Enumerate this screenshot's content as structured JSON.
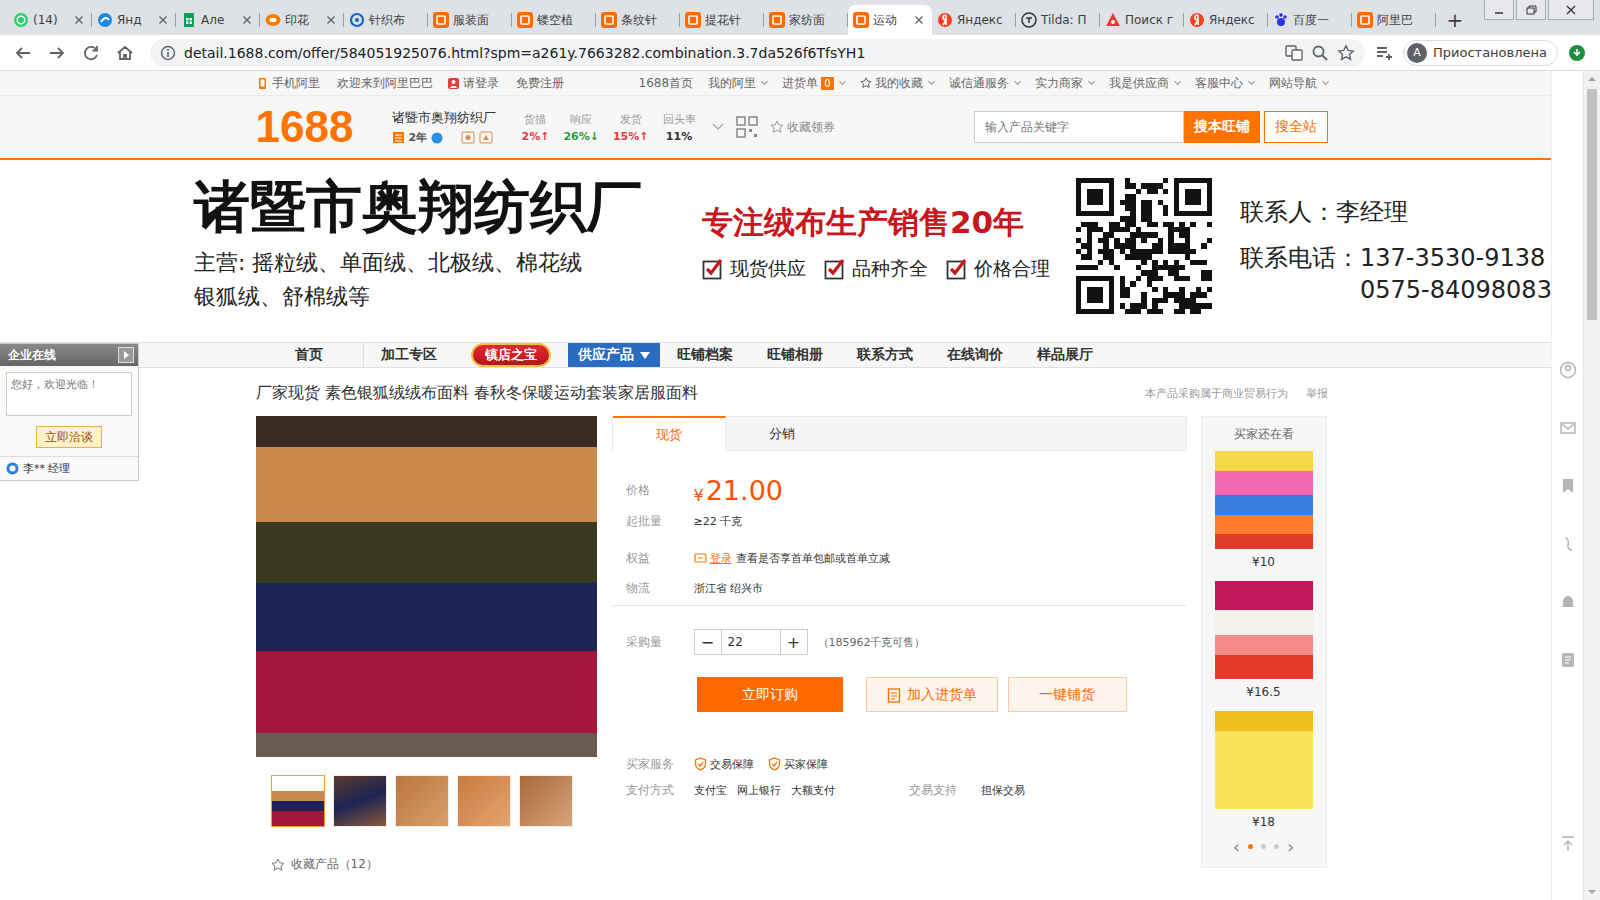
{
  "browser": {
    "tabs": [
      {
        "label": "(14)",
        "kind": "whatsapp",
        "closable": true,
        "selected": false
      },
      {
        "label": "Янд",
        "kind": "yandex-browser",
        "closable": true,
        "selected": false
      },
      {
        "label": "Але",
        "kind": "sheets",
        "closable": true,
        "selected": false
      },
      {
        "label": "印花",
        "kind": "aliexpress",
        "closable": true,
        "selected": false
      },
      {
        "label": "针织布",
        "kind": "alibaba",
        "closable": false,
        "selected": false
      },
      {
        "label": "服装面",
        "kind": "1688",
        "closable": false,
        "selected": false
      },
      {
        "label": "镂空植",
        "kind": "1688",
        "closable": false,
        "selected": false
      },
      {
        "label": "条纹针",
        "kind": "1688",
        "closable": false,
        "selected": false
      },
      {
        "label": "提花针",
        "kind": "1688",
        "closable": false,
        "selected": false
      },
      {
        "label": "家纺面",
        "kind": "1688",
        "closable": false,
        "selected": false
      },
      {
        "label": "运动",
        "kind": "1688",
        "closable": true,
        "selected": true
      },
      {
        "label": "Яндекс",
        "kind": "yandex",
        "closable": false,
        "selected": false
      },
      {
        "label": "Tilda: П",
        "kind": "tilda",
        "closable": false,
        "selected": false
      },
      {
        "label": "Поиск г",
        "kind": "search",
        "closable": false,
        "selected": false
      },
      {
        "label": "Яндекс",
        "kind": "yandex",
        "closable": false,
        "selected": false
      },
      {
        "label": "百度一",
        "kind": "baidu",
        "closable": false,
        "selected": false
      },
      {
        "label": "阿里巴",
        "kind": "1688",
        "closable": false,
        "selected": false
      }
    ],
    "new_tab": "+",
    "url": "detail.1688.com/offer/584051925076.html?spm=a261y.7663282.combination.3.7da526f6TfsYH1",
    "profile": {
      "initial": "A",
      "label": "Приостановлена"
    }
  },
  "top_nav": {
    "left": [
      {
        "label": "手机阿里",
        "kind": "phone"
      },
      {
        "label": "欢迎来到阿里巴巴",
        "kind": "text"
      },
      {
        "label": "请登录",
        "kind": "login"
      },
      {
        "label": "免费注册",
        "kind": "text"
      }
    ],
    "right": [
      {
        "label": "1688首页",
        "kind": "plain",
        "dropdown": false
      },
      {
        "label": "我的阿里",
        "kind": "plain",
        "dropdown": true
      },
      {
        "label": "进货单",
        "kind": "cart",
        "count": "0",
        "dropdown": true
      },
      {
        "label": "我的收藏",
        "kind": "favorites",
        "dropdown": true
      },
      {
        "label": "诚信通服务",
        "kind": "plain",
        "dropdown": true
      },
      {
        "label": "实力商家",
        "kind": "plain",
        "dropdown": true
      },
      {
        "label": "我是供应商",
        "kind": "plain",
        "dropdown": true
      },
      {
        "label": "客服中心",
        "kind": "plain",
        "dropdown": true
      },
      {
        "label": "网站导航",
        "kind": "plain",
        "dropdown": true
      }
    ]
  },
  "header": {
    "logo": "1688",
    "shop_name": "诸暨市奥翔纺织厂",
    "years": "2年",
    "metrics": [
      {
        "label": "货描",
        "value": "2%↑",
        "color": "#e4393c"
      },
      {
        "label": "响应",
        "value": "26%↓",
        "color": "#2b9a3a"
      },
      {
        "label": "发货",
        "value": "15%↑",
        "color": "#e4393c"
      },
      {
        "label": "回头率",
        "value": "11%",
        "color": "#333333"
      }
    ],
    "collect": "收藏领券",
    "search": {
      "placeholder": "输入产品关键字",
      "buttons": [
        {
          "label": "搜本旺铺",
          "primary": true
        },
        {
          "label": "搜全站",
          "primary": false
        }
      ]
    }
  },
  "banner": {
    "title": "诸暨市奥翔纺织厂",
    "main_lines": [
      "主营: 摇粒绒、单面绒、北极绒、棉花绒",
      "银狐绒、舒棉绒等"
    ],
    "slogan": "专注绒布生产销售20年",
    "features": [
      "现货供应",
      "品种齐全",
      "价格合理"
    ],
    "contacts": [
      {
        "label": "联系人：",
        "values": [
          "李经理"
        ]
      },
      {
        "label": "联系电话：",
        "values": [
          "137-3530-9138",
          "0575-84098083"
        ]
      }
    ]
  },
  "shop_nav": [
    {
      "label": "首页",
      "kind": "plain",
      "selected": false
    },
    {
      "label": "加工专区",
      "kind": "plain",
      "selected": false
    },
    {
      "label": "镇店之宝",
      "kind": "treasure",
      "selected": false
    },
    {
      "label": "供应产品",
      "kind": "menu",
      "selected": true
    },
    {
      "label": "旺铺档案",
      "kind": "plain",
      "selected": false
    },
    {
      "label": "旺铺相册",
      "kind": "plain",
      "selected": false
    },
    {
      "label": "联系方式",
      "kind": "plain",
      "selected": false
    },
    {
      "label": "在线询价",
      "kind": "plain",
      "selected": false
    },
    {
      "label": "样品展厅",
      "kind": "plain",
      "selected": false
    }
  ],
  "side_chat": {
    "title": "企业在线",
    "greeting": "您好，欢迎光临！",
    "button": "立即洽谈",
    "contact": "李** 经理"
  },
  "product": {
    "title": "厂家现货 素色银狐绒绒布面料 春秋冬保暖运动套装家居服面料",
    "notice": "本产品采购属于商业贸易行为",
    "report": "举报",
    "thumbnails": [
      {
        "selected": true
      },
      {
        "selected": false
      },
      {
        "selected": false
      },
      {
        "selected": false
      },
      {
        "selected": false
      }
    ],
    "favorite": "收藏产品（12）",
    "mode_tabs": [
      {
        "label": "现货",
        "selected": true
      },
      {
        "label": "分销",
        "selected": false
      }
    ],
    "price": {
      "label": "价格",
      "currency": "¥",
      "value": "21.00"
    },
    "min_order": {
      "label": "起批量",
      "value": "≥22 千克"
    },
    "benefit": {
      "label": "权益",
      "link": "登录",
      "text": "查看是否享首单包邮或首单立减"
    },
    "logistics": {
      "label": "物流",
      "value": "浙江省 绍兴市"
    },
    "quantity": {
      "label": "采购量",
      "minus": "−",
      "value": "22",
      "plus": "+",
      "stock": "（185962千克可售）"
    },
    "actions": [
      {
        "label": "立即订购",
        "kind": "primary"
      },
      {
        "label": "加入进货单",
        "kind": "cart"
      },
      {
        "label": "一键铺货",
        "kind": "secondary"
      }
    ],
    "services": {
      "label": "买家服务",
      "items": [
        "交易保障",
        "买家保障"
      ]
    },
    "payment": {
      "label": "支付方式",
      "items": [
        "支付宝",
        "网上银行",
        "大额支付"
      ]
    },
    "trade": {
      "label": "交易支持",
      "value": "担保交易"
    }
  },
  "related": {
    "title": "买家还在看",
    "items": [
      {
        "price": "¥10"
      },
      {
        "price": "¥16.5"
      },
      {
        "price": "¥18"
      }
    ],
    "prev": "‹",
    "next": "›",
    "pages": [
      {
        "selected": true
      },
      {
        "selected": false
      },
      {
        "selected": false
      }
    ]
  },
  "scrollbar": {
    "level": 0.29
  }
}
